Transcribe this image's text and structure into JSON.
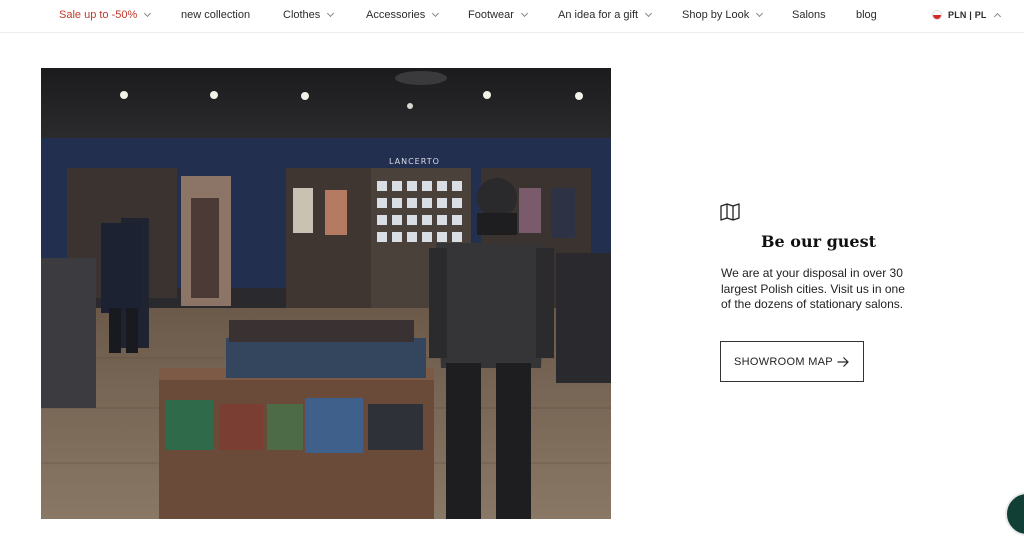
{
  "nav": {
    "items": [
      {
        "label": "Sale up to -50%",
        "dropdown": true
      },
      {
        "label": "new collection",
        "dropdown": false
      },
      {
        "label": "Clothes",
        "dropdown": true
      },
      {
        "label": "Accessories",
        "dropdown": true
      },
      {
        "label": "Footwear",
        "dropdown": true
      },
      {
        "label": "An idea for a gift",
        "dropdown": true
      },
      {
        "label": "Shop by Look",
        "dropdown": true
      },
      {
        "label": "Salons",
        "dropdown": false
      },
      {
        "label": "blog",
        "dropdown": false
      }
    ],
    "currency_label": "PLN | PL",
    "sale_color": "#c0392b"
  },
  "store_image": {
    "brand_sign": "LANCERTO"
  },
  "guest": {
    "icon": "map-icon",
    "title": "Be our guest",
    "description": "We are at your disposal in over 30 largest Polish cities. Visit us in one of the dozens of stationary salons.",
    "button_label": "SHOWROOM MAP"
  },
  "chat": {
    "icon": "chat-bubble-icon",
    "color": "#113e35"
  }
}
